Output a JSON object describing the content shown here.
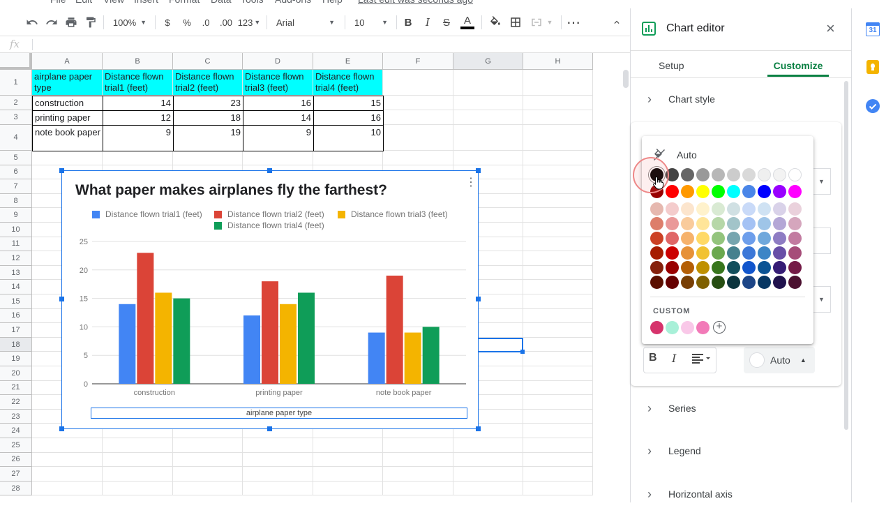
{
  "menu": {
    "items": [
      "File",
      "Edit",
      "View",
      "Insert",
      "Format",
      "Data",
      "Tools",
      "Add-ons",
      "Help"
    ],
    "last_edit": "Last edit was seconds ago"
  },
  "toolbar": {
    "zoom": "100%",
    "currency": "$",
    "percent": "%",
    "dec_decrease": ".0",
    "dec_increase": ".00",
    "format_more": "123",
    "font": "Arial",
    "font_size": "10",
    "bold": "B",
    "italic": "I",
    "strike": "S",
    "text_color": "A"
  },
  "formula": {
    "fx": "fx"
  },
  "grid": {
    "columns": [
      "A",
      "B",
      "C",
      "D",
      "E",
      "F",
      "G",
      "H"
    ],
    "rows": [
      "1",
      "2",
      "3",
      "4",
      "5",
      "6",
      "7",
      "8",
      "9",
      "10",
      "11",
      "12",
      "13",
      "14",
      "15",
      "16",
      "17",
      "18",
      "19",
      "20",
      "21",
      "22",
      "23",
      "24",
      "25",
      "26",
      "27",
      "28"
    ],
    "header_cells": [
      "airplane paper type",
      "Distance flown trial1 (feet)",
      "Distance flown trial2 (feet)",
      "Distance flown trial3 (feet)",
      "Distance flown trial4 (feet)"
    ],
    "data": [
      [
        "construction",
        "14",
        "23",
        "16",
        "15"
      ],
      [
        "printing paper",
        "12",
        "18",
        "14",
        "16"
      ],
      [
        "note book paper",
        "9",
        "19",
        "9",
        "10"
      ]
    ]
  },
  "chart_data": {
    "type": "bar",
    "title": "What paper makes airplanes fly the farthest?",
    "categories": [
      "construction",
      "printing paper",
      "note book paper"
    ],
    "series": [
      {
        "name": "Distance flown trial1 (feet)",
        "values": [
          14,
          12,
          9
        ],
        "color": "#4285f4"
      },
      {
        "name": "Distance flown trial2 (feet)",
        "values": [
          23,
          18,
          19
        ],
        "color": "#db4437"
      },
      {
        "name": "Distance flown trial3 (feet)",
        "values": [
          16,
          14,
          9
        ],
        "color": "#f4b400"
      },
      {
        "name": "Distance flown trial4 (feet)",
        "values": [
          15,
          16,
          10
        ],
        "color": "#0f9d58"
      }
    ],
    "ylim": [
      0,
      25
    ],
    "yticks": [
      "0",
      "5",
      "10",
      "15",
      "20",
      "25"
    ],
    "xlabel": "airplane paper type",
    "ylabel": "",
    "grid": true,
    "legend_position": "top"
  },
  "editor": {
    "title": "Chart editor",
    "tabs": [
      "Setup",
      "Customize"
    ],
    "active_tab": "Customize",
    "sections": [
      "Chart style",
      "Series",
      "Legend",
      "Horizontal axis"
    ],
    "color_picker": {
      "auto_label": "Auto",
      "custom_label": "CUSTOM",
      "selected": "#000000",
      "grays": [
        "#000000",
        "#434343",
        "#666666",
        "#999999",
        "#b7b7b7",
        "#cccccc",
        "#d9d9d9",
        "#efefef",
        "#f3f3f3",
        "#ffffff"
      ],
      "brights": [
        "#980000",
        "#ff0000",
        "#ff9900",
        "#ffff00",
        "#00ff00",
        "#00ffff",
        "#4a86e8",
        "#0000ff",
        "#9900ff",
        "#ff00ff"
      ],
      "tints": [
        [
          "#e6b8af",
          "#f4cccc",
          "#fce5cd",
          "#fff2cc",
          "#d9ead3",
          "#d0e0e3",
          "#c9daf8",
          "#cfe2f3",
          "#d9d2e9",
          "#ead1dc"
        ],
        [
          "#dd7e6b",
          "#ea9999",
          "#f9cb9c",
          "#ffe599",
          "#b6d7a8",
          "#a2c4c9",
          "#a4c2f4",
          "#9fc5e8",
          "#b4a7d6",
          "#d5a6bd"
        ],
        [
          "#cc4125",
          "#e06666",
          "#f6b26b",
          "#ffd966",
          "#93c47d",
          "#76a5af",
          "#6d9eeb",
          "#6fa8dc",
          "#8e7cc3",
          "#c27ba0"
        ],
        [
          "#a61c00",
          "#cc0000",
          "#e69138",
          "#f1c232",
          "#6aa84f",
          "#45818e",
          "#3c78d8",
          "#3d85c6",
          "#674ea7",
          "#a64d79"
        ],
        [
          "#85200c",
          "#990000",
          "#b45f06",
          "#bf9000",
          "#38761d",
          "#134f5c",
          "#1155cc",
          "#0b5394",
          "#351c75",
          "#741b47"
        ],
        [
          "#5b0f00",
          "#660000",
          "#783f04",
          "#7f6000",
          "#274e13",
          "#0c343d",
          "#1c4587",
          "#073763",
          "#20124d",
          "#4c1130"
        ]
      ],
      "custom": [
        "#d6336c",
        "#a8f0d8",
        "#f9c8e8",
        "#f27ab8"
      ]
    },
    "format_bold": "B",
    "format_italic": "I",
    "color_auto": "Auto"
  },
  "side_apps": {
    "calendar_day": "31"
  }
}
